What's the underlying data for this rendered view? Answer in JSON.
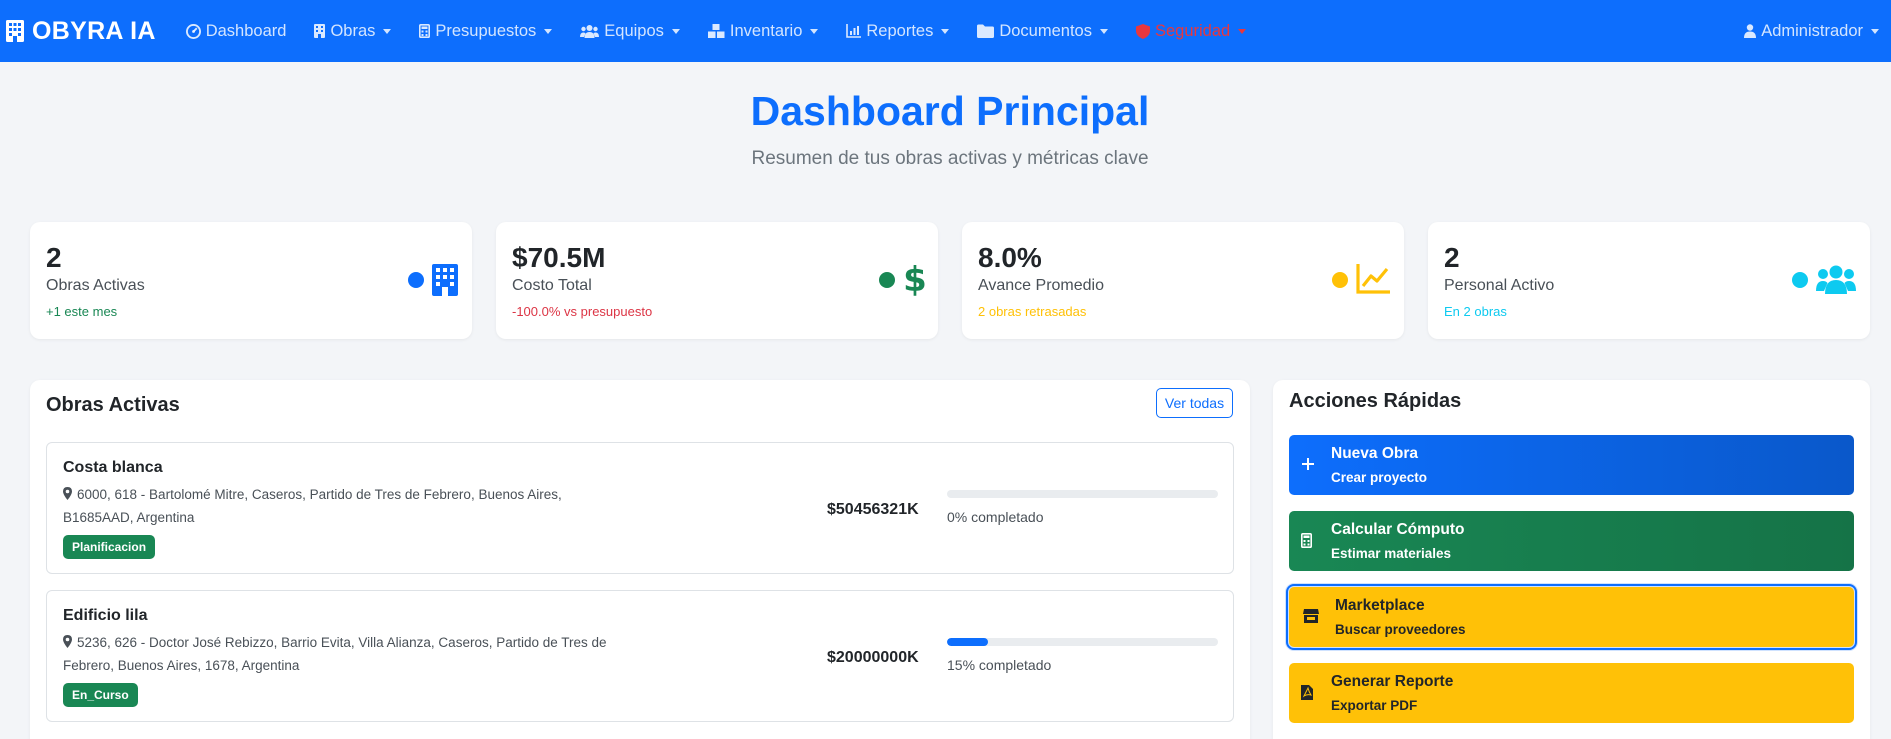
{
  "nav": {
    "brand": "OBYRA IA",
    "items": [
      {
        "label": "Dashboard",
        "icon": "dashboard-icon"
      },
      {
        "label": "Obras",
        "icon": "building-icon"
      },
      {
        "label": "Presupuestos",
        "icon": "calculator-icon"
      },
      {
        "label": "Equipos",
        "icon": "users-icon"
      },
      {
        "label": "Inventario",
        "icon": "boxes-icon"
      },
      {
        "label": "Reportes",
        "icon": "chart-icon"
      },
      {
        "label": "Documentos",
        "icon": "folder-icon"
      },
      {
        "label": "Seguridad",
        "icon": "shield-icon"
      }
    ],
    "user": "Administrador"
  },
  "header": {
    "title": "Dashboard Principal",
    "subtitle": "Resumen de tus obras activas y métricas clave"
  },
  "kpis": [
    {
      "value": "2",
      "label": "Obras Activas",
      "sub": "+1 este mes",
      "color": "#0d6efd",
      "sub_color": "#198754",
      "icon": "building-icon"
    },
    {
      "value": "$70.5M",
      "label": "Costo Total",
      "sub": "-100.0% vs presupuesto",
      "color": "#198754",
      "sub_color": "#dc3545",
      "icon": "dollar-icon"
    },
    {
      "value": "8.0%",
      "label": "Avance Promedio",
      "sub": "2 obras retrasadas",
      "color": "#ffc107",
      "sub_color": "#ffc107",
      "icon": "trend-chart-icon"
    },
    {
      "value": "2",
      "label": "Personal Activo",
      "sub": "En 2 obras",
      "color": "#0dcaf0",
      "sub_color": "#0dcaf0",
      "icon": "users-icon"
    }
  ],
  "obras_panel": {
    "title": "Obras Activas",
    "view_all": "Ver todas",
    "obras": [
      {
        "name": "Costa blanca",
        "address": "6000, 618 - Bartolomé Mitre, Caseros, Partido de Tres de Febrero, Buenos Aires, B1685AAD, Argentina",
        "status": "Planificacion",
        "cost": "$50456321K",
        "progress": 0,
        "progress_text": "0% completado"
      },
      {
        "name": "Edificio lila",
        "address": "5236, 626 - Doctor José Rebizzo, Barrio Evita, Villa Alianza, Caseros, Partido de Tres de Febrero, Buenos Aires, 1678, Argentina",
        "status": "En_Curso",
        "cost": "$20000000K",
        "progress": 15,
        "progress_text": "15% completado"
      }
    ]
  },
  "actions_panel": {
    "title": "Acciones Rápidas",
    "actions": [
      {
        "title": "Nueva Obra",
        "sub": "Crear proyecto",
        "icon": "plus-icon",
        "style": "blue"
      },
      {
        "title": "Calcular Cómputo",
        "sub": "Estimar materiales",
        "icon": "calculator-icon",
        "style": "green"
      },
      {
        "title": "Marketplace",
        "sub": "Buscar proveedores",
        "icon": "store-icon",
        "style": "yellow"
      },
      {
        "title": "Generar Reporte",
        "sub": "Exportar PDF",
        "icon": "pdf-file-icon",
        "style": "yellow"
      }
    ]
  }
}
